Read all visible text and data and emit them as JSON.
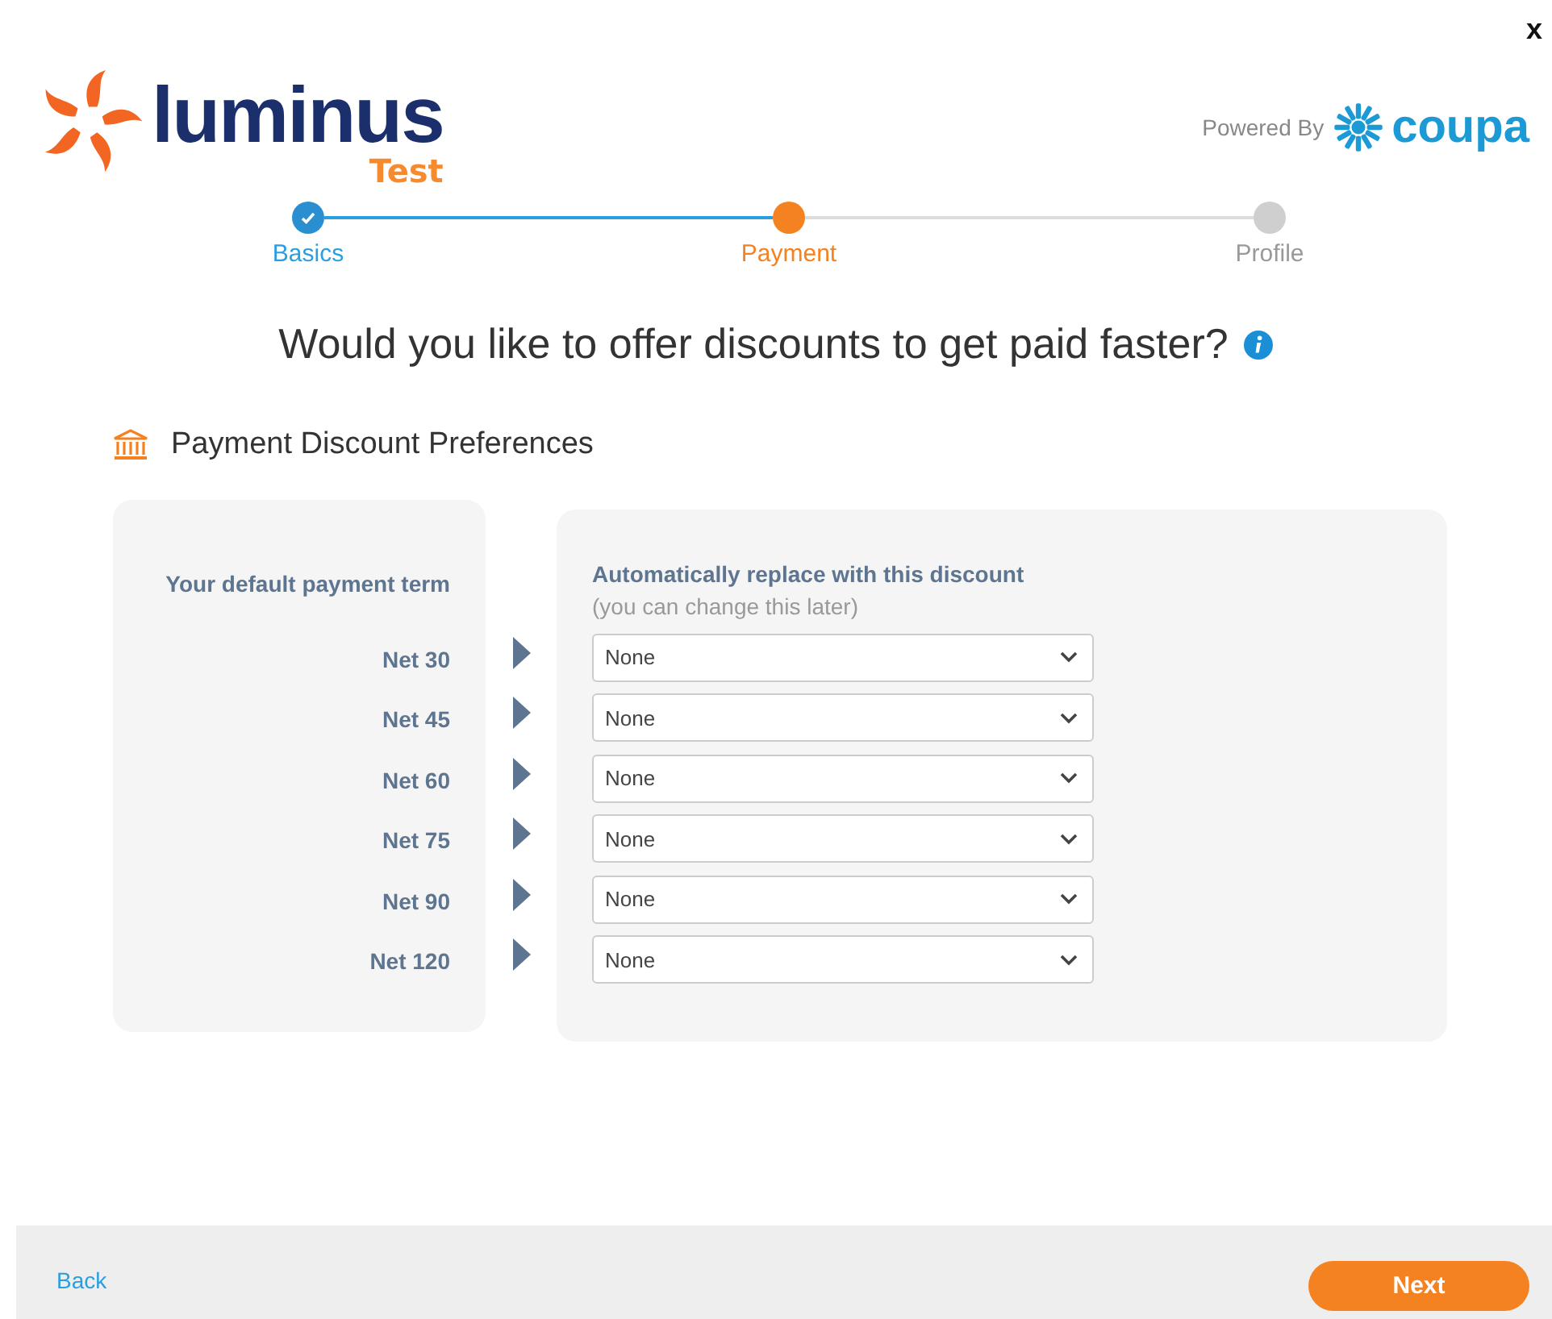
{
  "close_button": "x",
  "logo": {
    "name": "luminus",
    "tag": "Test"
  },
  "powered_by": {
    "label": "Powered By",
    "brand": "coupa"
  },
  "steps": [
    {
      "label": "Basics",
      "done": true,
      "selected": false
    },
    {
      "label": "Payment",
      "done": false,
      "selected": true
    },
    {
      "label": "Profile",
      "done": false,
      "selected": false
    }
  ],
  "question": "Would you like to offer discounts to get paid faster?",
  "section_title": "Payment Discount Preferences",
  "terms_panel": {
    "heading": "Your default payment term"
  },
  "discount_panel": {
    "heading": "Automatically replace with this discount",
    "note": "(you can change this later)"
  },
  "rows": [
    {
      "term": "Net 30",
      "discount": "None"
    },
    {
      "term": "Net 45",
      "discount": "None"
    },
    {
      "term": "Net 60",
      "discount": "None"
    },
    {
      "term": "Net 75",
      "discount": "None"
    },
    {
      "term": "Net 90",
      "discount": "None"
    },
    {
      "term": "Net 120",
      "discount": "None"
    }
  ],
  "footer": {
    "back": "Back",
    "next": "Next"
  }
}
